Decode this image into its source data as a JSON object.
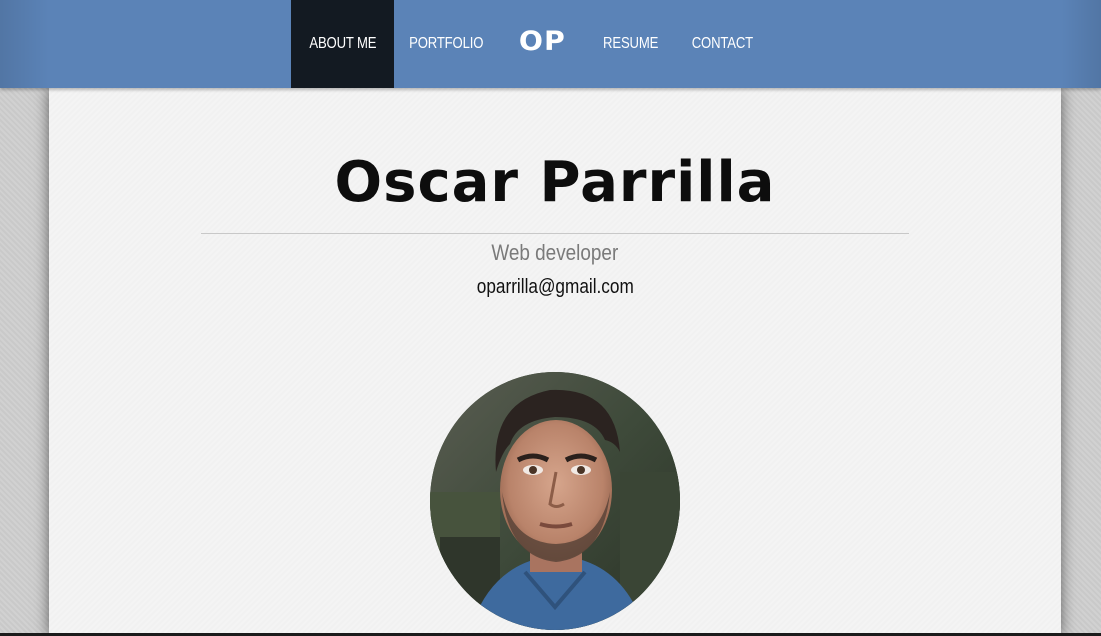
{
  "nav": {
    "items": [
      {
        "label": "ABOUT ME",
        "active": true
      },
      {
        "label": "PORTFOLIO",
        "active": false
      },
      {
        "label": "OP",
        "logo": true
      },
      {
        "label": "RESUME",
        "active": false
      },
      {
        "label": "CONTACT",
        "active": false
      }
    ]
  },
  "profile": {
    "name": "Oscar Parrilla",
    "role": "Web developer",
    "email": "oparrilla@gmail.com",
    "photo_icon": "profile-photo"
  },
  "colors": {
    "header": "#5b83b7",
    "active_tab": "#131a22",
    "panel": "#f4f4f4",
    "role_text": "#7a7a7a"
  }
}
